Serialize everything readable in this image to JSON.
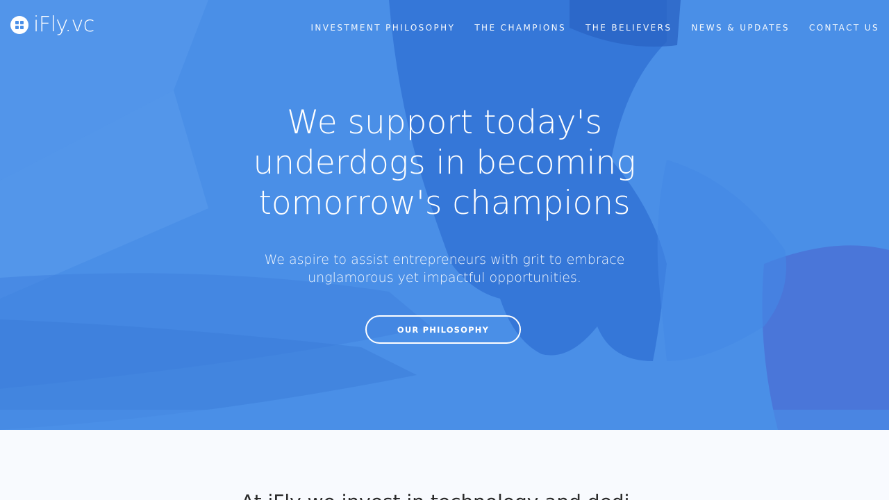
{
  "brand": {
    "name": "iFly.vc",
    "logo_icon": "four-squares-circle-icon",
    "accent_color": "#4a8fe7"
  },
  "nav": {
    "items": [
      {
        "label": "INVESTMENT PHILOSOPHY"
      },
      {
        "label": "THE CHAMPIONS"
      },
      {
        "label": "THE BELIEVERS"
      },
      {
        "label": "NEWS & UPDATES"
      },
      {
        "label": "CONTACT US"
      }
    ]
  },
  "hero": {
    "headline": "We support today's underdogs in becoming tomorrow's champions",
    "subheadline": "We aspire to assist entrepreneurs with grit to embrace unglamorous yet impactful opportunities.",
    "cta_label": "OUR PHILOSOPHY",
    "background": "hands-stacked-photo"
  },
  "section_intro": {
    "text_partial": "At iFly we invest in technology and dedi..."
  }
}
